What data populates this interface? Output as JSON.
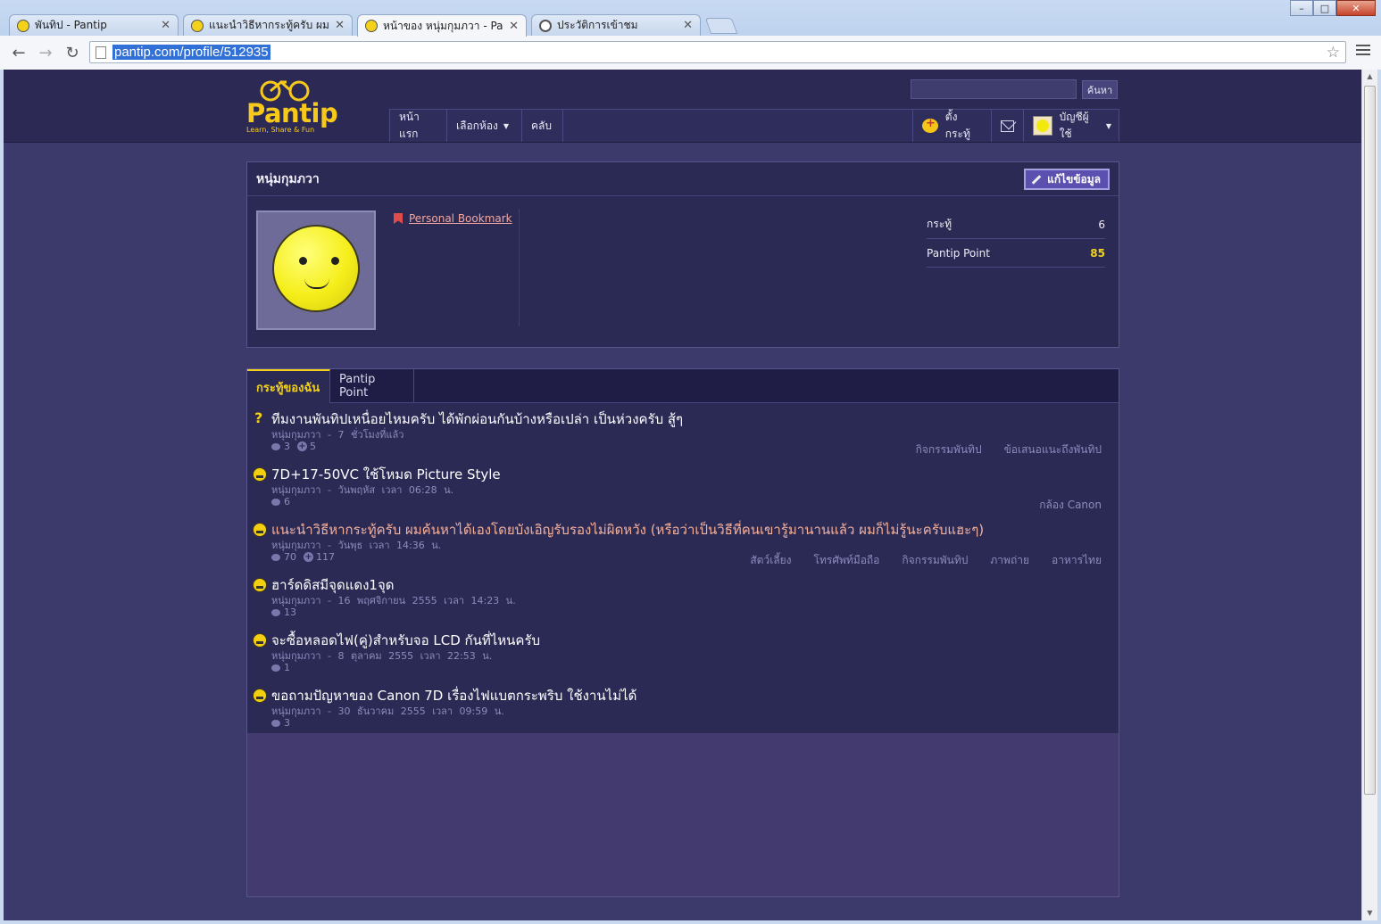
{
  "browser": {
    "tabs": [
      {
        "label": "พันทิป - Pantip",
        "icon": "pantip-favicon",
        "active": false
      },
      {
        "label": "แนะนำวิธีหากระทู้ครับ ผมค้น",
        "icon": "pantip-favicon",
        "active": false
      },
      {
        "label": "หน้าของ หนุ่มกุมภวา - Pantip",
        "icon": "pantip-favicon",
        "active": true
      },
      {
        "label": "ประวัติการเข้าชม",
        "icon": "history-clock-icon",
        "active": false
      }
    ],
    "url": "pantip.com/profile/512935"
  },
  "header": {
    "logo_text": "Pantip",
    "logo_tagline": "Learn, Share & Fun",
    "search_button": "ค้นหา",
    "nav": {
      "home": "หน้าแรก",
      "choose_room": "เลือกห้อง",
      "club": "คลับ",
      "new_topic": "ตั้งกระทู้",
      "account": "บัญชีผู้ใช้"
    }
  },
  "profile": {
    "name": "หนุ่มกุมภวา",
    "edit_button": "แก้ไขข้อมูล",
    "bookmark_link": "Personal Bookmark",
    "stats": [
      {
        "label": "กระทู้",
        "value": "6"
      },
      {
        "label": "Pantip Point",
        "value": "85"
      }
    ]
  },
  "topics_panel": {
    "tabs": [
      "กระทู้ของฉัน",
      "Pantip Point"
    ],
    "topics": [
      {
        "icon": "question-icon",
        "title": "ทีมงานพันทิปเหนื่อยไหมครับ ได้พักผ่อนกันบ้างหรือเปล่า เป็นห่วงครับ สู้ๆ",
        "author": "หนุ่มกุมภวา",
        "time": "- 7 ชั่วโมงที่แล้ว",
        "comments": "3",
        "plus": "5",
        "tags": [
          "กิจกรรมพันทิป",
          "ข้อเสนอแนะถึงพันทิป"
        ]
      },
      {
        "icon": "emoticon-icon",
        "title": "7D+17-50VC ใช้โหมด Picture Style",
        "author": "หนุ่มกุมภวา",
        "time": "- วันพฤหัส เวลา 06:28 น.",
        "comments": "6",
        "plus": "",
        "tags": [
          "กล้อง Canon"
        ]
      },
      {
        "icon": "emoticon-icon",
        "title": "แนะนำวิธีหากระทู้ครับ ผมค้นหาได้เองโดยบังเอิญรับรองไม่ผิดหวัง (หรือว่าเป็นวิธีที่คนเขารู้มานานแล้ว ผมก็ไม่รู้นะครับแฮะๆ)",
        "author": "หนุ่มกุมภวา",
        "time": "- วันพุธ เวลา 14:36 น.",
        "comments": "70",
        "plus": "117",
        "hot": true,
        "tags": [
          "สัตว์เลี้ยง",
          "โทรศัพท์มือถือ",
          "กิจกรรมพันทิป",
          "ภาพถ่าย",
          "อาหารไทย"
        ]
      },
      {
        "icon": "emoticon-icon",
        "title": "ฮาร์ดดิสมีจุดแดง1จุด",
        "author": "หนุ่มกุมภวา",
        "time": "- 16 พฤศจิกายน 2555 เวลา 14:23 น.",
        "comments": "13",
        "plus": "",
        "tags": []
      },
      {
        "icon": "emoticon-icon",
        "title": "จะซื้อหลอดไฟ(คู่)สำหรับจอ LCD กันที่ไหนครับ",
        "author": "หนุ่มกุมภวา",
        "time": "- 8 ตุลาคม 2555 เวลา 22:53 น.",
        "comments": "1",
        "plus": "",
        "tags": []
      },
      {
        "icon": "emoticon-icon",
        "title": "ขอถามปัญหาของ Canon 7D เรื่องไฟแบตกระพริบ ใช้งานไม่ได้",
        "author": "หนุ่มกุมภวา",
        "time": "- 30 ธันวาคม 2555 เวลา 09:59 น.",
        "comments": "3",
        "plus": "",
        "tags": []
      }
    ]
  },
  "colors": {
    "page_bg": "#3b3a6b",
    "panel_bg": "#2b2a55",
    "accent_yellow": "#f4d018",
    "hot_topic": "#f5b09a",
    "meta_text": "#8e8bbd"
  }
}
